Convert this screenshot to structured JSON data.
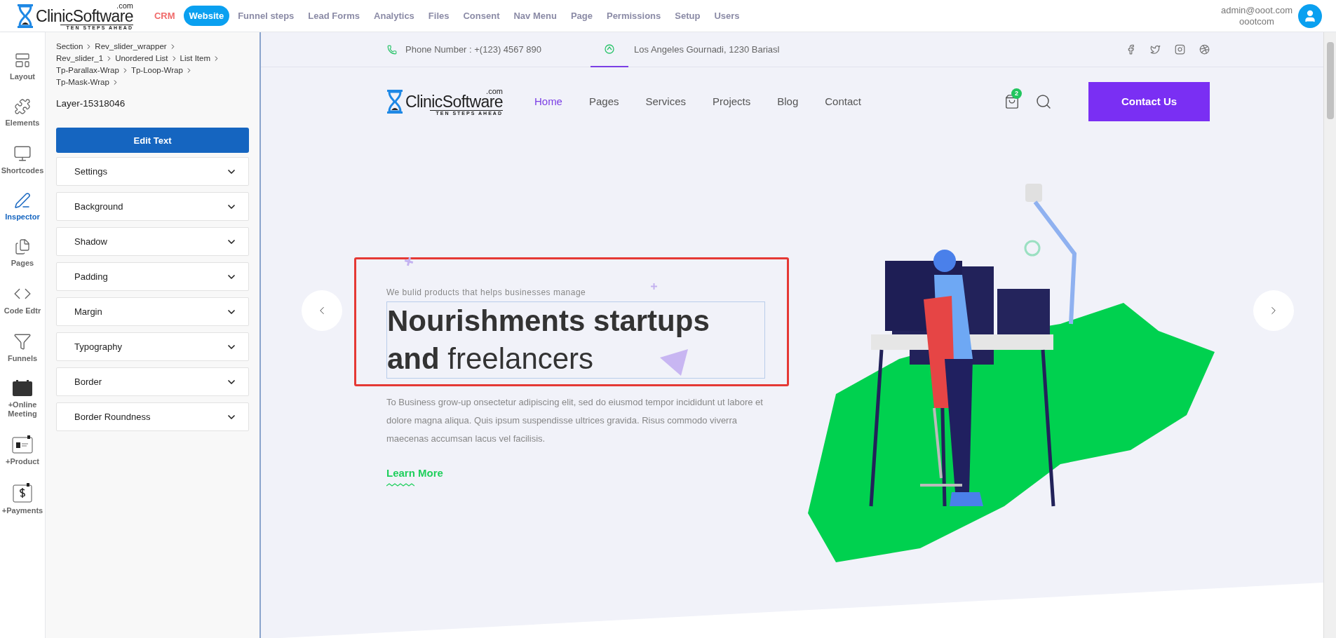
{
  "top_nav": {
    "brand": {
      "name": "ClinicSoftware",
      "suffix": ".com",
      "tagline": "TEN STEPS AHEAD"
    },
    "items": [
      {
        "label": "CRM",
        "kind": "accent",
        "selected": false
      },
      {
        "label": "Website",
        "kind": "plain",
        "selected": true
      },
      {
        "label": "Funnel steps",
        "kind": "plain",
        "selected": false
      },
      {
        "label": "Lead Forms",
        "kind": "plain",
        "selected": false
      },
      {
        "label": "Analytics",
        "kind": "plain",
        "selected": false
      },
      {
        "label": "Files",
        "kind": "plain",
        "selected": false
      },
      {
        "label": "Consent",
        "kind": "plain",
        "selected": false
      },
      {
        "label": "Nav Menu",
        "kind": "plain",
        "selected": false
      },
      {
        "label": "Page",
        "kind": "plain",
        "selected": false
      },
      {
        "label": "Permissions",
        "kind": "plain",
        "selected": false
      },
      {
        "label": "Setup",
        "kind": "plain",
        "selected": false
      },
      {
        "label": "Users",
        "kind": "plain",
        "selected": false
      }
    ],
    "user": {
      "email": "admin@ooot.com",
      "name": "oootcom"
    }
  },
  "tool_rail": [
    {
      "label": "Layout",
      "selected": false
    },
    {
      "label": "Elements",
      "selected": false
    },
    {
      "label": "Shortcodes",
      "selected": false
    },
    {
      "label": "Inspector",
      "selected": true
    },
    {
      "label": "Pages",
      "selected": false
    },
    {
      "label": "Code Edtr",
      "selected": false
    },
    {
      "label": "Funnels",
      "selected": false
    },
    {
      "label": "+Online Meeting",
      "selected": false
    },
    {
      "label": "+Product",
      "selected": false
    },
    {
      "label": "+Payments",
      "selected": false
    }
  ],
  "inspector": {
    "breadcrumb": [
      "Section",
      "Rev_slider_wrapper",
      "Rev_slider_1",
      "Unordered List",
      "List Item",
      "Tp-Parallax-Wrap",
      "Tp-Loop-Wrap",
      "Tp-Mask-Wrap"
    ],
    "layer": "Layer-15318046",
    "edit_button": "Edit Text",
    "sections": [
      {
        "label": "Settings",
        "expanded": false
      },
      {
        "label": "Background",
        "expanded": false
      },
      {
        "label": "Shadow",
        "expanded": false
      },
      {
        "label": "Padding",
        "expanded": false
      },
      {
        "label": "Margin",
        "expanded": false
      },
      {
        "label": "Typography",
        "expanded": false
      },
      {
        "label": "Border",
        "expanded": false
      },
      {
        "label": "Border Roundness",
        "expanded": false
      }
    ]
  },
  "site": {
    "contact_bar": {
      "phone": "Phone Number : +(123) 4567 890",
      "address": "Los Angeles Gournadi, 1230 Bariasl"
    },
    "brand": {
      "name": "ClinicSoftware",
      "suffix": ".com",
      "tagline": "TEN STEPS AHEAD"
    },
    "nav": [
      {
        "label": "Home",
        "selected": true
      },
      {
        "label": "Pages",
        "selected": false
      },
      {
        "label": "Services",
        "selected": false
      },
      {
        "label": "Projects",
        "selected": false
      },
      {
        "label": "Blog",
        "selected": false
      },
      {
        "label": "Contact",
        "selected": false
      }
    ],
    "cart_count": "2",
    "cta": "Contact Us",
    "hero": {
      "eyebrow": "We bulid products that helps businesses manage",
      "heading": "**Nourishments startups and** freelancers",
      "body": "To Business grow-up onsectetur adipiscing elit, sed do eiusmod tempor incididunt ut labore et dolore magna aliqua. Quis ipsum suspendisse ultrices gravida. Risus commodo viverra maecenas accumsan lacus vel facilisis.",
      "link": "Learn More"
    }
  }
}
